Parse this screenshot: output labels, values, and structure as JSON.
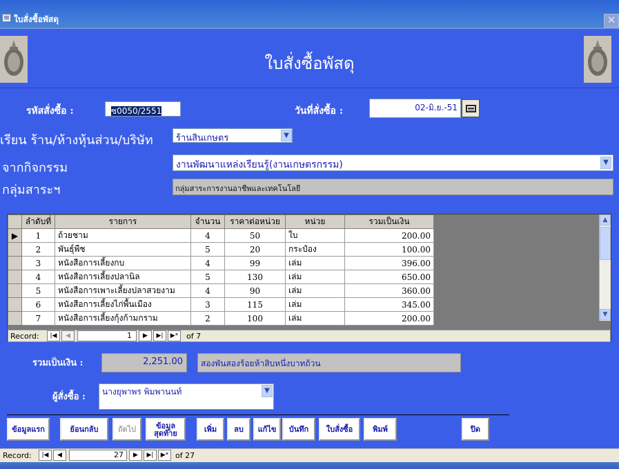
{
  "window": {
    "title": "ใบสั่งซื้อพัสดุ",
    "close_glyph": "✕"
  },
  "header": {
    "title": "ใบสั่งซื้อพัสดุ"
  },
  "form": {
    "order_no_label": "รหัสสั่งซื้อ :",
    "order_no_value": "ซ0050/2551",
    "order_date_label": "วันที่สั่งซื้อ :",
    "order_date_value": "02-มิ.ย.-51",
    "shop_label": "เรียน ร้าน/ห้างหุ้นส่วน/บริษัท",
    "shop_value": "ร้านสินเกษตร",
    "activity_label": "จากกิจกรรม",
    "activity_value": "งานพัฒนาแหล่งเรียนรู้(งานเกษตรกรรม)",
    "group_label": "กลุ่มสาระฯ",
    "group_value": "กลุ่มสาระการงานอาชีพและเทคโนโลยี"
  },
  "grid": {
    "columns": [
      "ลำดับที่",
      "รายการ",
      "จำนวน",
      "ราคาต่อหน่วย",
      "หน่วย",
      "รวมเป็นเงิน"
    ],
    "rows": [
      [
        "1",
        "ถ้วยชาม",
        "4",
        "50",
        "ใบ",
        "200.00"
      ],
      [
        "2",
        "พันธุ์พืช",
        "5",
        "20",
        "กระป๋อง",
        "100.00"
      ],
      [
        "3",
        "หนังสือการเลี้ยงกบ",
        "4",
        "99",
        "เล่ม",
        "396.00"
      ],
      [
        "4",
        "หนังสือการเลี้ยงปลานิล",
        "5",
        "130",
        "เล่ม",
        "650.00"
      ],
      [
        "5",
        "หนังสือการเพาะเลี้ยงปลาสวยงาม",
        "4",
        "90",
        "เล่ม",
        "360.00"
      ],
      [
        "6",
        "หนังสือการเลี้ยงไก่พื้นเมือง",
        "3",
        "115",
        "เล่ม",
        "345.00"
      ],
      [
        "7",
        "หนังสือการเลี้ยงกุ้งก้ามกราม",
        "2",
        "100",
        "เล่ม",
        "200.00"
      ]
    ],
    "selector_glyph": "▶"
  },
  "sub_nav": {
    "label": "Record:",
    "current": "1",
    "of_text": "of 7"
  },
  "totals": {
    "total_label": "รวมเป็นเงิน :",
    "total_value": "2,251.00",
    "total_words": "สองพันสองร้อยห้าสิบหนึ่งบาทถ้วน",
    "buyer_label": "ผู้สั่งซื้อ :",
    "buyer_value": "นางยุพาพร  พิมพานนท์"
  },
  "buttons": {
    "first": "ข้อมูลแรก",
    "prev": "ย้อนกลับ",
    "next": "ถัดไป",
    "last_line1": "ข้อมูล",
    "last_line2": "สุดท้าย",
    "add": "เพิ่ม",
    "delete": "ลบ",
    "edit": "แก้ไข",
    "save": "บันทึก",
    "order_form": "ใบสั่งซื้อ",
    "print": "พิมพ์",
    "close": "ปิด"
  },
  "main_nav": {
    "label": "Record:",
    "current": "27",
    "of_text": "of 27"
  },
  "colors": {
    "form_bg": "#3b5ee8",
    "title_bar": "#2d63d6",
    "grid_bg": "#7b7b7b",
    "button_text": "#1a1aa8"
  }
}
